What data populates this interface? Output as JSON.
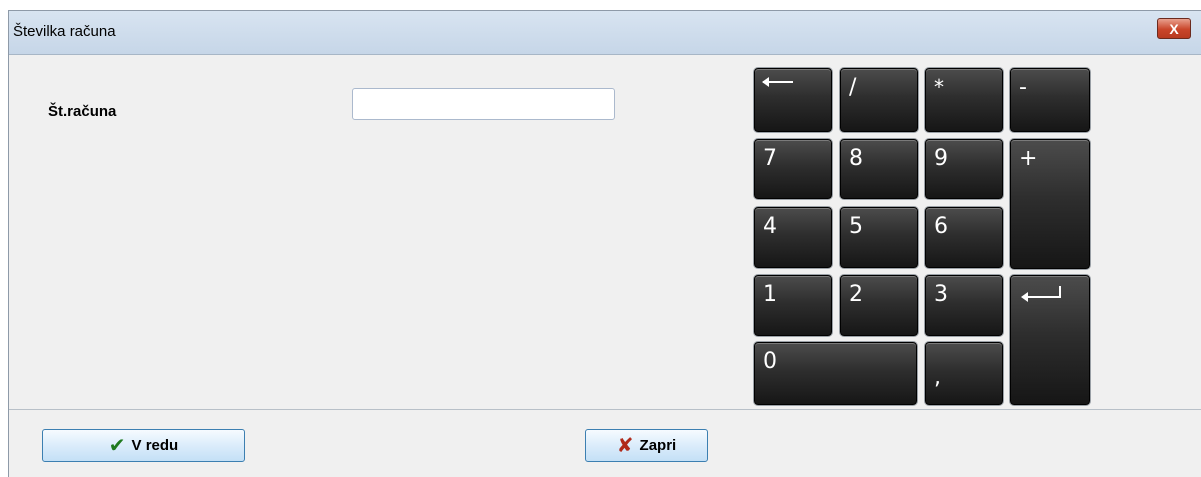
{
  "window": {
    "title": "Številka računa",
    "close_label": "X"
  },
  "form": {
    "invoice_label": "Št.računa",
    "invoice_value": "",
    "invoice_placeholder": ""
  },
  "keypad": {
    "backspace": "",
    "divide": "/",
    "multiply": "*",
    "minus": "-",
    "k7": "7",
    "k8": "8",
    "k9": "9",
    "plus": "+",
    "k4": "4",
    "k5": "5",
    "k6": "6",
    "k1": "1",
    "k2": "2",
    "k3": "3",
    "enter": "",
    "k0": "0",
    "comma": ","
  },
  "footer": {
    "ok_label": "V redu",
    "ok_icon": "check-icon",
    "close_label": "Zapri",
    "close_icon": "x-icon"
  }
}
